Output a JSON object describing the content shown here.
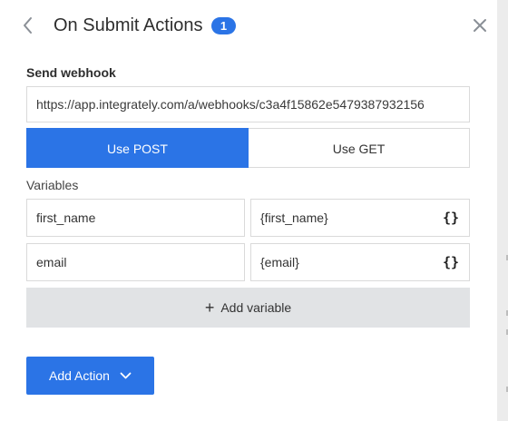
{
  "header": {
    "title": "On Submit Actions",
    "count": "1",
    "back_icon": "chevron-left-icon",
    "close_icon": "close-icon"
  },
  "webhook": {
    "label": "Send webhook",
    "url": "https://app.integrately.com/a/webhooks/c3a4f15862e5479387932156",
    "methods": [
      "Use POST",
      "Use GET"
    ],
    "selected_method": "Use POST"
  },
  "variables": {
    "label": "Variables",
    "rows": [
      {
        "name": "first_name",
        "value": "{first_name}",
        "picker": "{}"
      },
      {
        "name": "email",
        "value": "{email}",
        "picker": "{}"
      }
    ],
    "add_label": "Add variable"
  },
  "actions": {
    "add_label": "Add Action"
  },
  "colors": {
    "accent": "#2b74e6",
    "add_variable_bg": "#e1e3e5",
    "border": "#dadada"
  }
}
